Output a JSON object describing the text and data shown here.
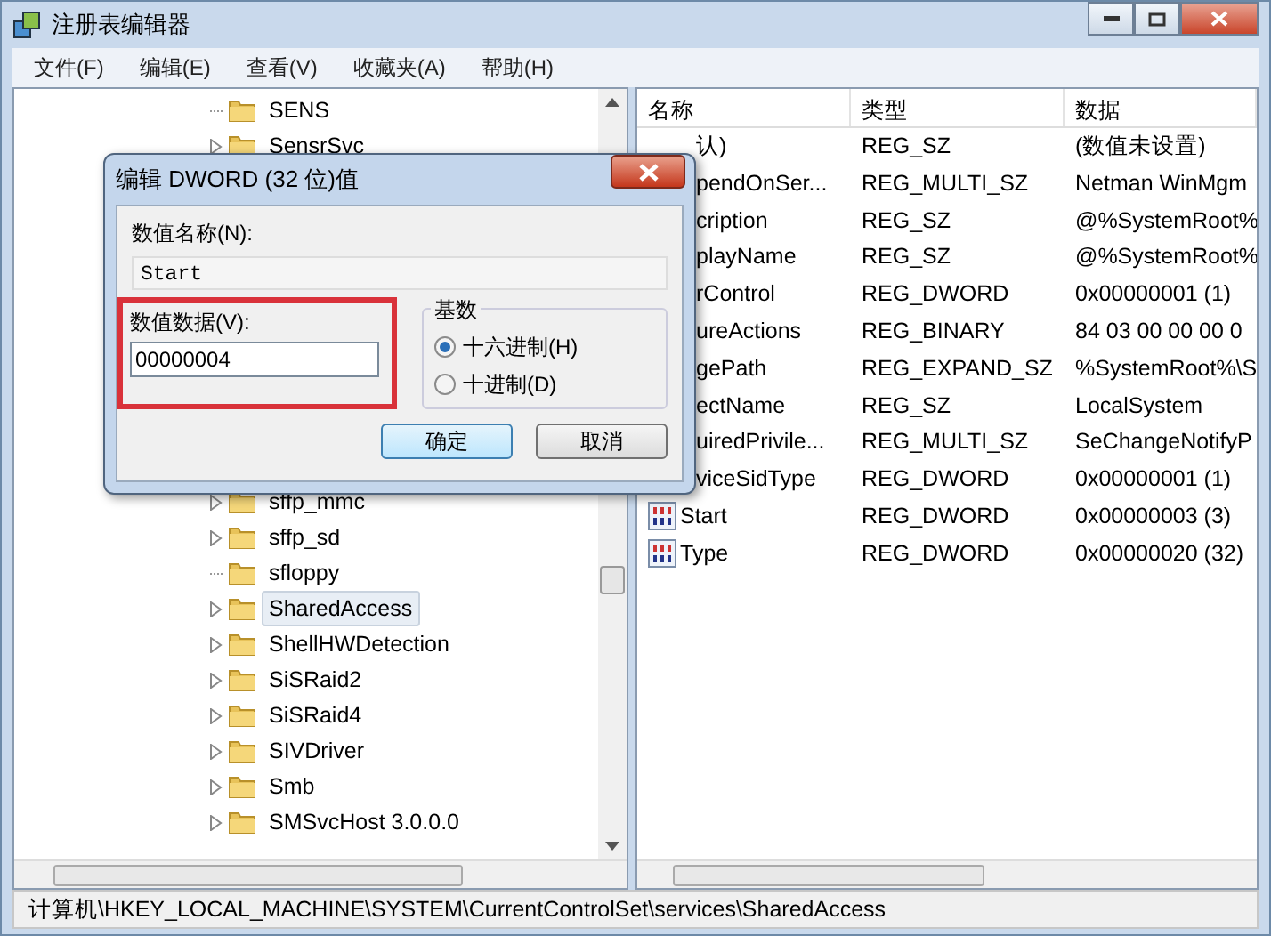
{
  "window": {
    "title": "注册表编辑器"
  },
  "menu": [
    "文件(F)",
    "编辑(E)",
    "查看(V)",
    "收藏夹(A)",
    "帮助(H)"
  ],
  "tree": {
    "items_above_dialog": [
      {
        "label": "SENS",
        "expandable": false,
        "selected": false
      },
      {
        "label": "SensrSvc",
        "expandable": true,
        "selected": false
      }
    ],
    "items_below_dialog": [
      {
        "label": "sffp_mmc",
        "expandable": true,
        "selected": false
      },
      {
        "label": "sffp_sd",
        "expandable": true,
        "selected": false
      },
      {
        "label": "sfloppy",
        "expandable": false,
        "selected": false
      },
      {
        "label": "SharedAccess",
        "expandable": true,
        "selected": true
      },
      {
        "label": "ShellHWDetection",
        "expandable": true,
        "selected": false
      },
      {
        "label": "SiSRaid2",
        "expandable": true,
        "selected": false
      },
      {
        "label": "SiSRaid4",
        "expandable": true,
        "selected": false
      },
      {
        "label": "SIVDriver",
        "expandable": true,
        "selected": false
      },
      {
        "label": "Smb",
        "expandable": true,
        "selected": false
      },
      {
        "label": "SMSvcHost 3.0.0.0",
        "expandable": true,
        "selected": false
      }
    ]
  },
  "values": {
    "columns": [
      "名称",
      "类型",
      "数据"
    ],
    "rows": [
      {
        "kind": "partial",
        "name": "认)",
        "type": "REG_SZ",
        "data": "(数值未设置)"
      },
      {
        "kind": "partial",
        "name": "pendOnSer...",
        "type": "REG_MULTI_SZ",
        "data": "Netman WinMgm"
      },
      {
        "kind": "partial",
        "name": "cription",
        "type": "REG_SZ",
        "data": "@%SystemRoot%"
      },
      {
        "kind": "partial",
        "name": "playName",
        "type": "REG_SZ",
        "data": "@%SystemRoot%"
      },
      {
        "kind": "partial",
        "name": "rControl",
        "type": "REG_DWORD",
        "data": "0x00000001 (1)"
      },
      {
        "kind": "partial",
        "name": "ureActions",
        "type": "REG_BINARY",
        "data": "84 03 00 00 00 0"
      },
      {
        "kind": "partial",
        "name": "gePath",
        "type": "REG_EXPAND_SZ",
        "data": "%SystemRoot%\\S"
      },
      {
        "kind": "partial",
        "name": "ectName",
        "type": "REG_SZ",
        "data": "LocalSystem"
      },
      {
        "kind": "partial",
        "name": "uiredPrivile...",
        "type": "REG_MULTI_SZ",
        "data": "SeChangeNotifyP"
      },
      {
        "kind": "partial",
        "name": "viceSidType",
        "type": "REG_DWORD",
        "data": "0x00000001 (1)"
      },
      {
        "kind": "full",
        "name": "Start",
        "type": "REG_DWORD",
        "data": "0x00000003 (3)"
      },
      {
        "kind": "full",
        "name": "Type",
        "type": "REG_DWORD",
        "data": "0x00000020 (32)"
      }
    ]
  },
  "dialog": {
    "title": "编辑 DWORD (32 位)值",
    "name_label": "数值名称(N):",
    "name_value": "Start",
    "data_label": "数值数据(V):",
    "data_value": "00000004",
    "base_label": "基数",
    "bases": [
      {
        "label": "十六进制(H)",
        "selected": true
      },
      {
        "label": "十进制(D)",
        "selected": false
      }
    ],
    "buttons": [
      {
        "label": "确定",
        "default": true
      },
      {
        "label": "取消",
        "default": false
      }
    ]
  },
  "status_bar": "计算机\\HKEY_LOCAL_MACHINE\\SYSTEM\\CurrentControlSet\\services\\SharedAccess"
}
